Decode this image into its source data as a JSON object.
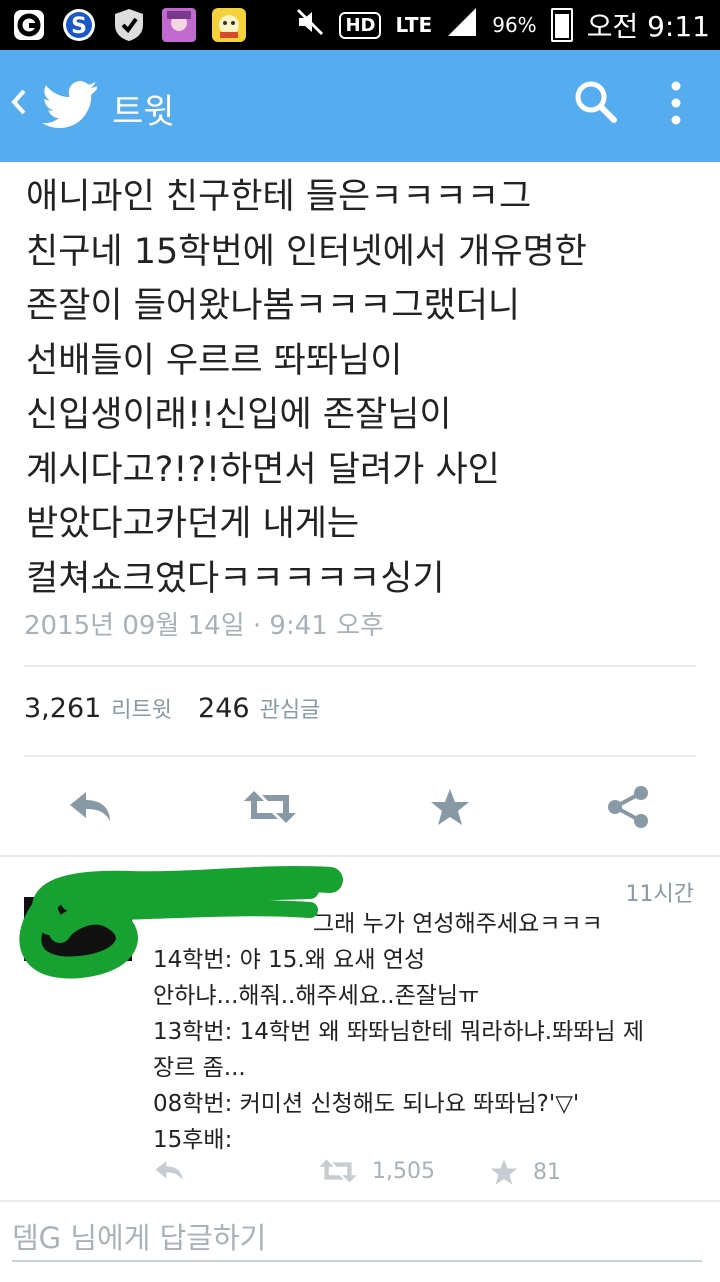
{
  "status_bar": {
    "battery": "96%",
    "time": "오전 9:11",
    "network": "LTE",
    "hd": "HD"
  },
  "header": {
    "title": "트윗",
    "back_icon": "chevron-left-icon",
    "logo_icon": "twitter-bird-icon",
    "search_icon": "search-icon",
    "menu_icon": "more-vertical-icon",
    "color": "#55acee"
  },
  "tweet": {
    "lines": [
      "애니과인 친구한테 들은ㅋㅋㅋㅋ그",
      "친구네 15학번에 인터넷에서 개유명한",
      "존잘이 들어왔나봄ㅋㅋㅋ그랬더니",
      "선배들이 우르르 똬똬님이",
      "신입생이래!!신입에 존잘님이",
      "계시다고?!?!하면서 달려가 사인",
      "받았다고카던게 내게는",
      "컬쳐쇼크였다ㅋㅋㅋㅋㅋ싱기"
    ],
    "timestamp": "2015년 09월 14일 · 9:41 오후",
    "retweet_count": "3,261",
    "retweet_label": "리트윗",
    "like_count": "246",
    "like_label": "관심글"
  },
  "reply": {
    "time": "11시간",
    "lines": [
      "그래 누가 연성해주세요ㅋㅋㅋ",
      "14학번: 야 15.왜 요새 연성",
      "안하냐...해줘..해주세요..존잘님ㅠ",
      "13학번: 14학번 왜 똬똬님한테 뭐라하냐.똬똬님 제",
      "장르 좀...",
      "08학번: 커미션 신청해도 되나요 똬똬님?'▽'",
      "15후배:"
    ],
    "retweet_count": "1,505",
    "like_count": "81"
  },
  "compose": {
    "placeholder": "뎀G 님에게 답글하기"
  }
}
